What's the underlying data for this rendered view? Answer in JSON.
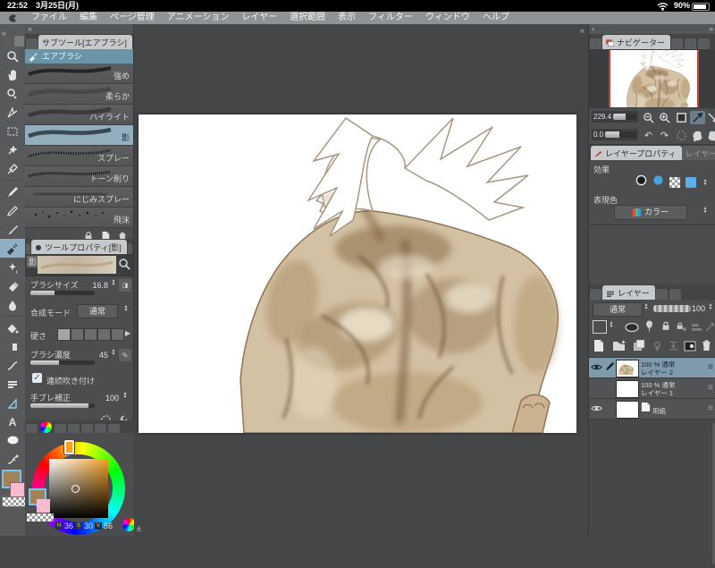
{
  "status_bar": {
    "time": "22:52",
    "date": "3月25日(月)",
    "battery": "90%"
  },
  "menu_bar": {
    "items": [
      "ファイル",
      "編集",
      "ページ管理",
      "アニメーション",
      "レイヤー",
      "選択範囲",
      "表示",
      "フィルター",
      "ウィンドウ",
      "ヘルプ"
    ]
  },
  "subtool": {
    "tab": "サブツール[エアブラシ]",
    "group": "エアブラシ",
    "items": [
      {
        "label": "強め"
      },
      {
        "label": "柔らか"
      },
      {
        "label": "ハイライト"
      },
      {
        "label": "影"
      },
      {
        "label": "スプレー"
      },
      {
        "label": "トーン削り"
      },
      {
        "label": "にじみスプレー"
      },
      {
        "label": "飛沫"
      }
    ]
  },
  "tool_property": {
    "tab": "ツールプロパティ[影]",
    "preview_label": "影",
    "brush_size_label": "ブラシサイズ",
    "brush_size": "16.8",
    "blend_mode_label": "合成モード",
    "blend_mode": "通常",
    "hardness_label": "硬さ",
    "density_label": "ブラシ濃度",
    "density": "45",
    "continuous_spray_label": "連続吹き付け",
    "stabilization_label": "手ブレ補正",
    "stabilization": "100"
  },
  "color_panel": {
    "h": "36",
    "s": "30",
    "v": "56",
    "foreground_hex": "#a08457",
    "background_hex": "#f9b9cf"
  },
  "navigator": {
    "tab": "ナビゲーター",
    "zoom": "229.4",
    "rotation": "0.0"
  },
  "layer_property": {
    "tab": "レイヤープロパティ",
    "tab_search": "レイヤー検索",
    "effect_label": "効果",
    "expression_label": "表現色",
    "expression_value": "カラー"
  },
  "layers": {
    "tab": "レイヤー",
    "blend_mode": "通常",
    "opacity": "100",
    "items": [
      {
        "info": "100 % 通常",
        "name": "レイヤー 2"
      },
      {
        "info": "100 % 通常",
        "name": "レイヤー 1"
      },
      {
        "info": "",
        "name": "用紙"
      }
    ]
  }
}
